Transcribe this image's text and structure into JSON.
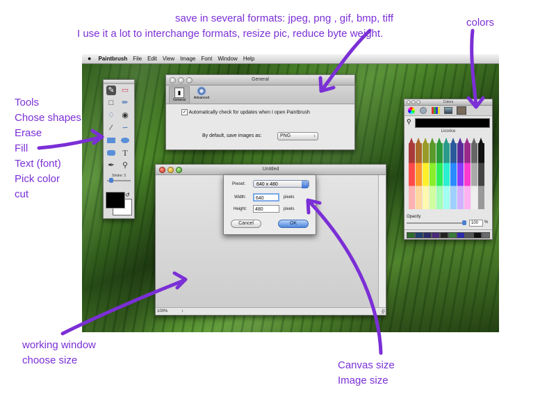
{
  "annotations": {
    "formats_title": "save in several formats: jpeg, png , gif, bmp, tiff",
    "formats_sub": "I use it a lot to interchange formats, resize pic, reduce byte weight.",
    "colors": "colors",
    "tools_list": [
      "Tools",
      "Chose shapes",
      "Erase",
      "Fill",
      "Text (font)",
      "Pick color",
      "cut"
    ],
    "working_window_1": "working window",
    "working_window_2": "choose size",
    "canvas_size": "Canvas size",
    "image_size": "Image size",
    "arrow_color": "#7b2fd6"
  },
  "menubar": {
    "app_name": "Paintbrush",
    "items": [
      "File",
      "Edit",
      "View",
      "Image",
      "Font",
      "Window",
      "Help"
    ]
  },
  "general_window": {
    "title": "General",
    "tabs": [
      "General",
      "Advanced"
    ],
    "checkbox_label": "Automatically check for updates when I open Paintbrush",
    "checkbox_checked": true,
    "save_label": "By default, save images as:",
    "save_format": "PNG"
  },
  "toolbox": {
    "stroke_label": "Stroke: 3",
    "foreground_color": "#000000",
    "background_color": "#ffffff"
  },
  "untitled_window": {
    "title": "Untitled",
    "zoom": "100%",
    "dialog": {
      "preset_label": "Preset:",
      "preset_value": "640 x 480",
      "width_label": "Width:",
      "width_value": "640",
      "height_label": "Height:",
      "height_value": "480",
      "unit": "pixels",
      "cancel": "Cancel",
      "ok": "OK"
    }
  },
  "colors_window": {
    "title": "Colors",
    "selected_name": "Licorice",
    "opacity_label": "Opacity",
    "opacity_value": "100",
    "opacity_unit": "%",
    "crayons_top": [
      "#ffffff",
      "#e6e6e6",
      "#cccccc",
      "#b3b3b3",
      "#999999",
      "#808080",
      "#666666",
      "#4d4d4d",
      "#333333",
      "#1a1a1a",
      "#000000"
    ],
    "crayons_mid": [
      "#800000",
      "#804000",
      "#808000",
      "#408000",
      "#008000",
      "#008040",
      "#008080",
      "#004080",
      "#000080",
      "#400080",
      "#800080"
    ],
    "crayons_bottom": [
      "#ff0000",
      "#ff8000",
      "#ffff00",
      "#80ff00",
      "#00ff00",
      "#00ff80",
      "#00ffff",
      "#0080ff",
      "#0000ff",
      "#8000ff",
      "#ff00ff"
    ],
    "swatches": [
      "#2e6b2e",
      "#1f3f6f",
      "#2a2a6a",
      "#4a2a7a",
      "#222222",
      "#3a7a3a",
      "#2a2aaa",
      "#555555",
      "#111111",
      "#6a6a6a"
    ]
  }
}
